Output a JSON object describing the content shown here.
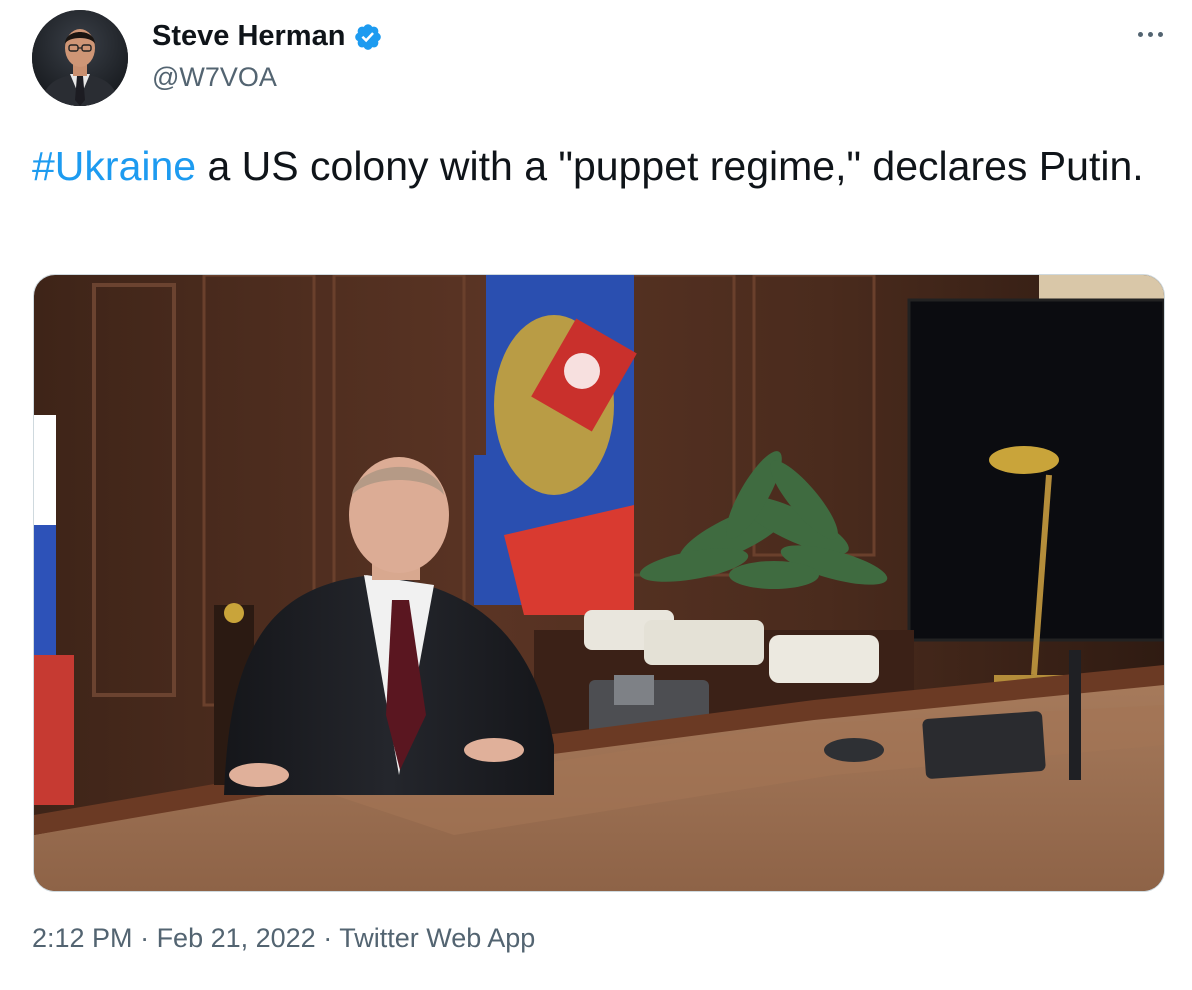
{
  "author": {
    "display_name": "Steve Herman",
    "handle": "@W7VOA",
    "verified": true
  },
  "tweet": {
    "hashtag": "#Ukraine",
    "text": " a US colony with a \"puppet regime,\" declares Putin."
  },
  "meta": {
    "time": "2:12 PM",
    "separator1": " · ",
    "date": "Feb 21, 2022",
    "separator2": " · ",
    "source": "Twitter Web App"
  },
  "icons": {
    "verified": "verified-badge-icon",
    "more": "more-options-icon"
  },
  "colors": {
    "link": "#1d9bf0",
    "secondary_text": "#536471",
    "primary_text": "#0f1419",
    "border": "#cfd9de"
  }
}
